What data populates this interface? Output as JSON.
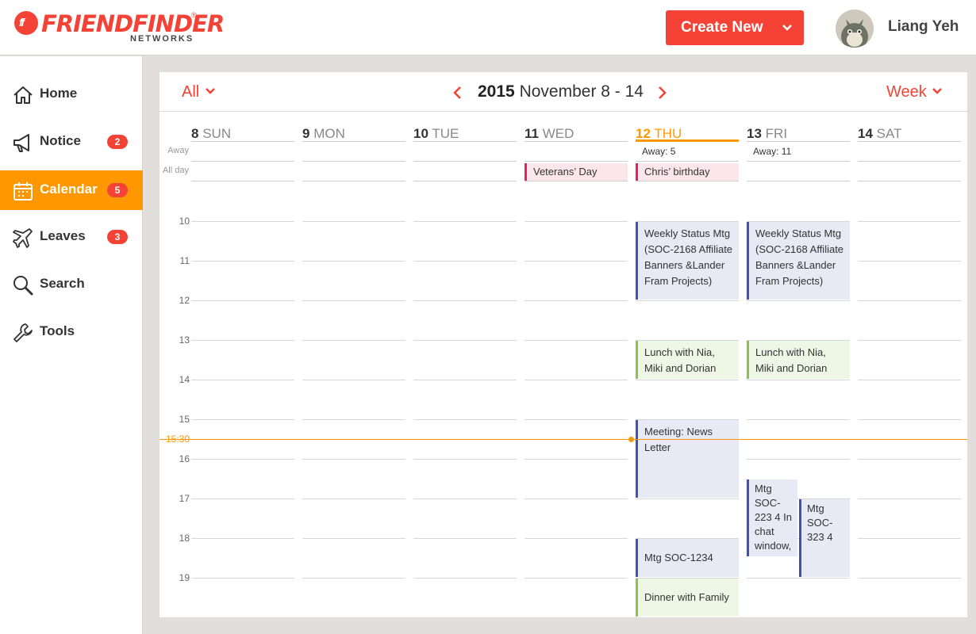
{
  "header": {
    "logo_text": "FRIENDFINDER",
    "logo_sub": "NETWORKS",
    "create_button": "Create New",
    "user_name": "Liang Yeh"
  },
  "sidebar": {
    "items": [
      {
        "label": "Home",
        "icon": "home-icon",
        "badge": null
      },
      {
        "label": "Notice",
        "icon": "megaphone-icon",
        "badge": "2"
      },
      {
        "label": "Calendar",
        "icon": "calendar-icon",
        "badge": "5",
        "active": true
      },
      {
        "label": "Leaves",
        "icon": "airplane-icon",
        "badge": "3"
      },
      {
        "label": "Search",
        "icon": "search-icon",
        "badge": null
      },
      {
        "label": "Tools",
        "icon": "wrench-icon",
        "badge": null
      }
    ]
  },
  "toolbar": {
    "filter": "All",
    "year": "2015",
    "range": "November 8 - 14",
    "view": "Week"
  },
  "row_labels": {
    "away": "Away",
    "allday": "All day"
  },
  "days": [
    {
      "num": "8",
      "name": "SUN",
      "away": "",
      "allday": ""
    },
    {
      "num": "9",
      "name": "MON",
      "away": "",
      "allday": ""
    },
    {
      "num": "10",
      "name": "TUE",
      "away": "",
      "allday": ""
    },
    {
      "num": "11",
      "name": "WED",
      "away": "",
      "allday": "Veterans’ Day"
    },
    {
      "num": "12",
      "name": "THU",
      "away": "Away: 5",
      "allday": "Chris’ birthday",
      "today": true
    },
    {
      "num": "13",
      "name": "FRI",
      "away": "Away: 11",
      "allday": ""
    },
    {
      "num": "14",
      "name": "SAT",
      "away": "",
      "allday": ""
    }
  ],
  "hours": [
    "10",
    "11",
    "12",
    "13",
    "14",
    "15",
    "16",
    "17",
    "18",
    "19"
  ],
  "now_label": "15:30",
  "events": [
    {
      "day": "THU",
      "type": "meeting",
      "title": "Weekly Status Mtg (SOC-2168 Affiliate Banners &Lander Fram Projects)"
    },
    {
      "day": "FRI",
      "type": "meeting",
      "title": "Weekly Status Mtg (SOC-2168 Affiliate Banners &Lander Fram Projects)"
    },
    {
      "day": "THU",
      "type": "social",
      "title": "Lunch with Nia, Miki and Dorian"
    },
    {
      "day": "FRI",
      "type": "social",
      "title": "Lunch with Nia, Miki and Dorian"
    },
    {
      "day": "THU",
      "type": "meeting",
      "title": "Meeting: News Letter"
    },
    {
      "day": "FRI",
      "type": "meeting",
      "title": "Mtg SOC-223 4 In chat window, ..."
    },
    {
      "day": "FRI",
      "type": "meeting",
      "title": "Mtg SOC-323 4"
    },
    {
      "day": "THU",
      "type": "meeting",
      "title": "Mtg SOC-1234"
    },
    {
      "day": "THU",
      "type": "social",
      "title": "Dinner with Family"
    }
  ],
  "colors": {
    "accent": "#f44336",
    "today": "#ff9800",
    "meeting": "#3f51b5",
    "social": "#8bc34a",
    "holiday": "#e91e63"
  }
}
